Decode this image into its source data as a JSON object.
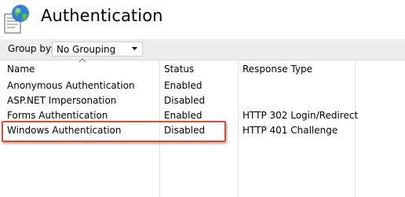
{
  "page": {
    "title": "Authentication"
  },
  "toolbar": {
    "group_by_label": "Group by:",
    "group_by_value": "No Grouping"
  },
  "columns": [
    "Name",
    "Status",
    "Response Type"
  ],
  "rows": [
    {
      "name": "Anonymous Authentication",
      "status": "Enabled",
      "response_type": ""
    },
    {
      "name": "ASP.NET Impersonation",
      "status": "Disabled",
      "response_type": ""
    },
    {
      "name": "Forms Authentication",
      "status": "Enabled",
      "response_type": "HTTP 302 Login/Redirect"
    },
    {
      "name": "Windows Authentication",
      "status": "Disabled",
      "response_type": "HTTP 401 Challenge"
    }
  ],
  "colors": {
    "highlight_border": "#e04b2e",
    "toolbar_background": "#ededed"
  },
  "icons": {
    "header": "globe-document-icon",
    "sort": "sort-ascending-icon",
    "dropdown": "chevron-down-icon"
  }
}
